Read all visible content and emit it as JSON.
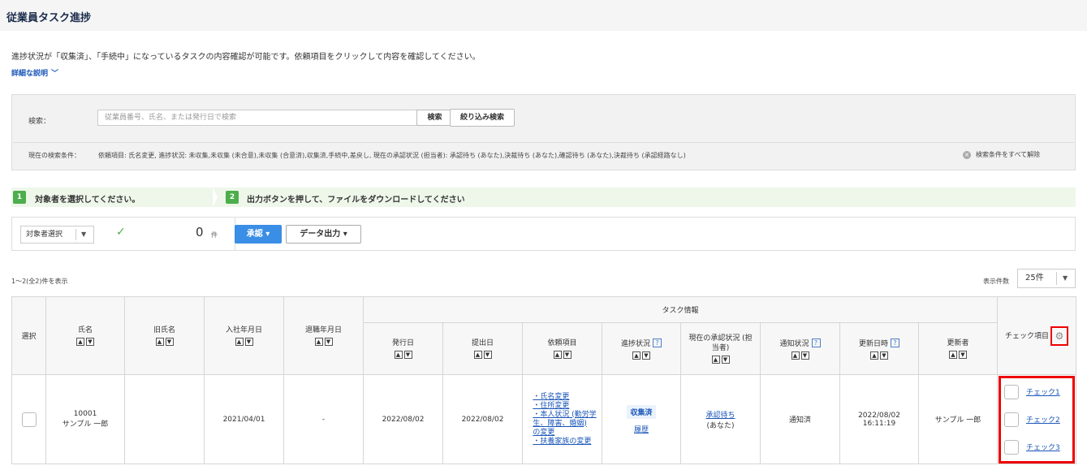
{
  "page_title": "従業員タスク進捗",
  "description": "進捗状況が「収集済」、「手続中」になっているタスクの内容確認が可能です。依頼項目をクリックして内容を確認してください。",
  "detail_link": "詳細な説明",
  "search": {
    "label": "検索：",
    "placeholder": "従業員番号、氏名、または発行日で検索",
    "search_button": "検索",
    "filter_button": "絞り込み検索",
    "condition_label": "現在の検索条件：",
    "condition_text": "依頼項目: 氏名変更, 進捗状況: 未収集,未収集 (未合意),未収集 (合意済),収集済,手続中,差戻し, 現在の承認状況 (担当者): 承認待ち (あなた),決裁待ち (あなた),確認待ち (あなた),決裁待ち (承認経路なし)",
    "clear_all": "検索条件をすべて解除"
  },
  "steps": {
    "step1_number": "1",
    "step1_text": "対象者を選択してください。",
    "step2_number": "2",
    "step2_text": "出力ボタンを押して、ファイルをダウンロードしてください"
  },
  "actions": {
    "select_label": "対象者選択",
    "count": "0",
    "count_unit": "件",
    "approve_button": "承認",
    "export_button": "データ出力"
  },
  "list": {
    "range_text": "1〜2(全2)件を表示",
    "per_page_label": "表示件数",
    "per_page_value": "25件"
  },
  "table": {
    "headers": {
      "select": "選択",
      "name": "氏名",
      "old_name": "旧氏名",
      "hire_date": "入社年月日",
      "leave_date": "退職年月日",
      "task_info": "タスク情報",
      "issue_date": "発行日",
      "submit_date": "提出日",
      "request_items": "依頼項目",
      "progress": "進捗状況",
      "approval_status": "現在の承認状況 (担当者)",
      "notify_status": "通知状況",
      "updated_at": "更新日時",
      "updated_by": "更新者",
      "check_items": "チェック項目"
    },
    "row": {
      "employee_id": "10001",
      "name": "サンプル 一郎",
      "old_name": "",
      "hire_date": "2021/04/01",
      "leave_date": "-",
      "issue_date": "2022/08/02",
      "submit_date": "2022/08/02",
      "request_items": [
        "・氏名変更",
        "・住所変更",
        "・本人状況 (勤労学",
        "生、障害、婚姻)",
        "の変更",
        "・扶養家族の変更"
      ],
      "progress_tag": "収集済",
      "progress_link": "履歴",
      "approval_link": "承認待ち",
      "approval_sub": "(あなた)",
      "notify_status": "通知済",
      "updated_date": "2022/08/02",
      "updated_time": "16:11:19",
      "updated_by": "サンプル 一郎",
      "checks": [
        "チェック1",
        "チェック2",
        "チェック3"
      ]
    }
  },
  "icons": {
    "chevron": "chevron-down-icon",
    "gear": "gear-icon",
    "clear": "clear-icon",
    "check": "check-icon",
    "help": "help-icon"
  },
  "colors": {
    "accent_blue": "#3a8ee6",
    "link_blue": "#1a56b8",
    "step_green": "#4cae4c",
    "highlight_red": "#e00000"
  }
}
